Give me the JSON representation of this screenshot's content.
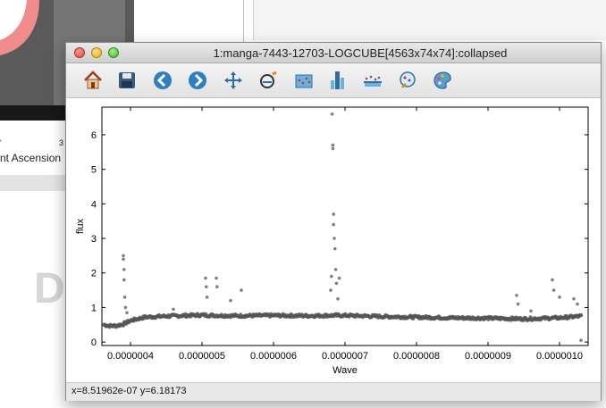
{
  "background_window": {
    "xlabel": "nt Ascension",
    "tick_a": "'",
    "tick_b": "3",
    "dim_letter": "D"
  },
  "window": {
    "title": "1:manga-7443-12703-LOGCUBE[4563x74x74]:collapsed"
  },
  "toolbar": {
    "tools": [
      {
        "name": "home-icon",
        "label": "Home"
      },
      {
        "name": "save-icon",
        "label": "Save"
      },
      {
        "name": "back-icon",
        "label": "Back"
      },
      {
        "name": "forward-icon",
        "label": "Forward"
      },
      {
        "name": "pan-icon",
        "label": "Pan"
      },
      {
        "name": "zoom-icon",
        "label": "Zoom"
      },
      {
        "name": "scatter-select-icon",
        "label": "Select region"
      },
      {
        "name": "histogram-icon",
        "label": "Histogram"
      },
      {
        "name": "line-plot-icon",
        "label": "Line plot"
      },
      {
        "name": "chart-options-icon",
        "label": "Options"
      },
      {
        "name": "palette-icon",
        "label": "Colors"
      }
    ]
  },
  "status": {
    "text": "x=8.51962e-07  y=6.18173"
  },
  "chart_data": {
    "type": "scatter",
    "title": "",
    "xlabel": "Wave",
    "ylabel": "flux",
    "xlim": [
      3.6e-07,
      1.04e-06
    ],
    "ylim": [
      -0.1,
      6.8
    ],
    "xticks": [
      4e-07,
      5e-07,
      6e-07,
      7e-07,
      8e-07,
      9e-07,
      1e-06
    ],
    "xtick_labels": [
      "0.0000004",
      "0.0000005",
      "0.0000006",
      "0.0000007",
      "0.0000008",
      "0.0000009",
      "0.0000010"
    ],
    "yticks": [
      0,
      1,
      2,
      3,
      4,
      5,
      6
    ],
    "ytick_labels": [
      "0",
      "1",
      "2",
      "3",
      "4",
      "5",
      "6"
    ],
    "grid": false,
    "marker_color": "#555555",
    "baseline": {
      "x": [
        3.63e-07,
        3.7e-07,
        3.8e-07,
        3.9e-07,
        4e-07,
        4.2e-07,
        4.5e-07,
        4.8e-07,
        5e-07,
        5.2e-07,
        5.5e-07,
        6e-07,
        6.5e-07,
        6.8e-07,
        7e-07,
        7.5e-07,
        8e-07,
        8.5e-07,
        9e-07,
        9.5e-07,
        1e-06,
        1.03e-06
      ],
      "y": [
        0.5,
        0.47,
        0.47,
        0.52,
        0.62,
        0.72,
        0.75,
        0.77,
        0.78,
        0.77,
        0.76,
        0.77,
        0.76,
        0.77,
        0.77,
        0.74,
        0.72,
        0.7,
        0.69,
        0.67,
        0.7,
        0.75
      ]
    },
    "outliers": {
      "x": [
        3.9e-07,
        3.9e-07,
        3.91e-07,
        3.91e-07,
        3.92e-07,
        3.93e-07,
        3.95e-07,
        4.6e-07,
        5.05e-07,
        5.06e-07,
        5.07e-07,
        5.2e-07,
        5.21e-07,
        5.4e-07,
        5.55e-07,
        6.8e-07,
        6.81e-07,
        6.82e-07,
        6.83e-07,
        6.83e-07,
        6.84e-07,
        6.84e-07,
        6.85e-07,
        6.86e-07,
        6.87e-07,
        6.88e-07,
        6.9e-07,
        6.92e-07,
        9.4e-07,
        9.42e-07,
        9.6e-07,
        9.9e-07,
        9.92e-07,
        1e-06,
        1.02e-06,
        1.025e-06,
        1.03e-06
      ],
      "y": [
        2.5,
        2.4,
        2.1,
        1.8,
        1.3,
        1.0,
        0.85,
        0.95,
        1.85,
        1.6,
        1.3,
        1.85,
        1.6,
        1.2,
        1.5,
        1.5,
        1.9,
        6.6,
        5.7,
        5.6,
        3.7,
        3.4,
        3.0,
        2.7,
        2.1,
        1.7,
        1.25,
        1.85,
        1.35,
        1.1,
        0.9,
        1.8,
        1.5,
        1.3,
        1.25,
        1.1,
        0.05
      ]
    }
  }
}
